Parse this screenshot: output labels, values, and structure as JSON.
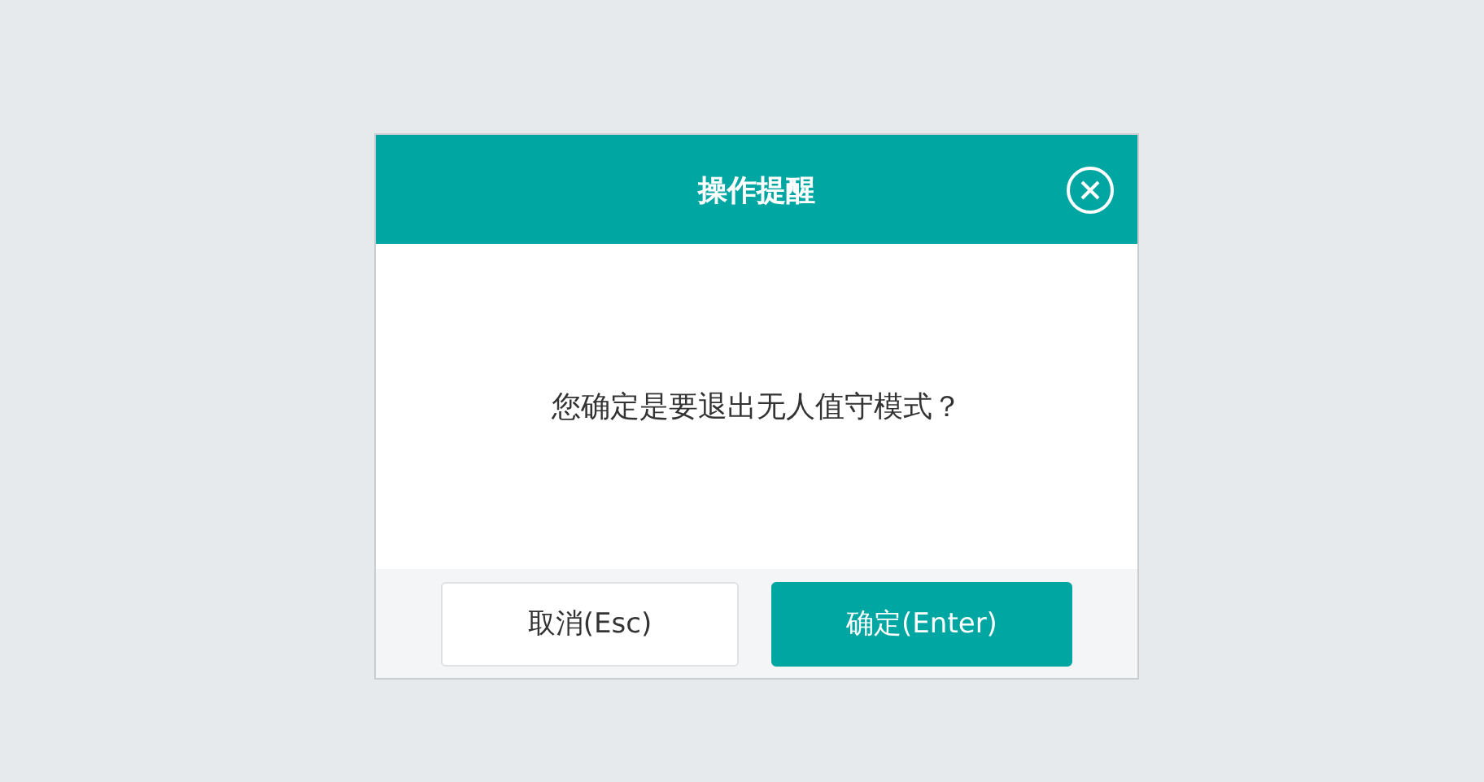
{
  "dialog": {
    "title": "操作提醒",
    "message": "您确定是要退出无人值守模式？",
    "buttons": [
      {
        "label": "取消(Esc)",
        "kind": "secondary"
      },
      {
        "label": "确定(Enter)",
        "kind": "primary"
      }
    ]
  }
}
